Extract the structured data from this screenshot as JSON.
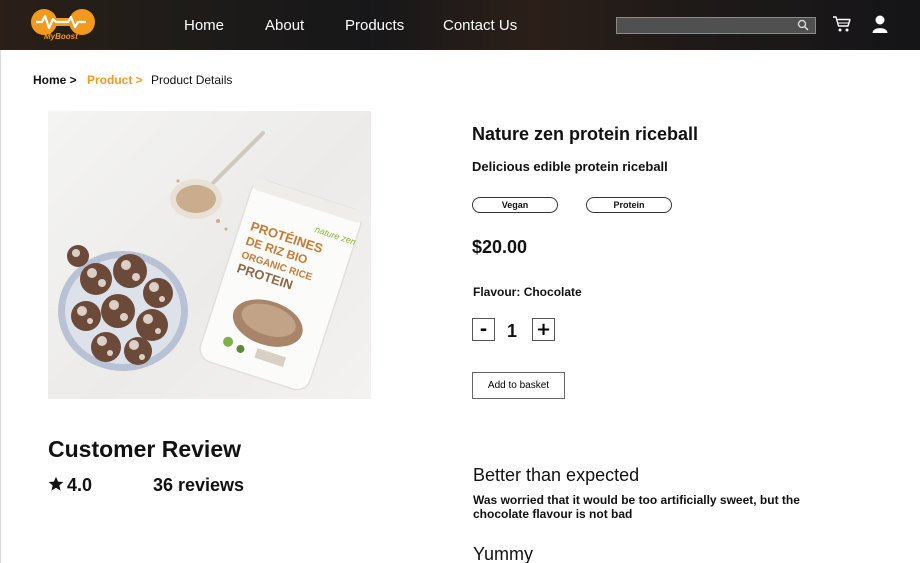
{
  "brand": {
    "logo_text": "MyBoost",
    "accent_color": "#f39a1e"
  },
  "nav": {
    "items": [
      "Home",
      "About",
      "Products",
      "Contact Us"
    ],
    "search_placeholder": "",
    "icons": [
      "search-icon",
      "cart-icon",
      "user-icon"
    ]
  },
  "breadcrumb": {
    "home": "Home >",
    "product": "Product >",
    "current": "Product Details"
  },
  "product": {
    "title": "Nature zen protein riceball",
    "subtitle": "Delicious edible protein riceball",
    "tags": [
      "Vegan",
      "Protein"
    ],
    "price": "$20.00",
    "flavour_label": "Flavour:",
    "flavour_value": "Chocolate",
    "quantity": "1",
    "minus_label": "-",
    "plus_label": "+",
    "add_to_basket": "Add to basket",
    "image": {
      "jar_text_lines": [
        "nature zen",
        "PROTÉINES",
        "DE RIZ BIO",
        "ORGANIC RICE",
        "PROTEIN"
      ]
    }
  },
  "reviews": {
    "heading": "Customer Review",
    "rating": "4.0",
    "count": "36 reviews",
    "items": [
      {
        "title": "Better than expected",
        "body": "Was worried that it would be too artificially sweet, but the chocolate flavour is not bad"
      },
      {
        "title": "Yummy",
        "body": ""
      }
    ]
  }
}
